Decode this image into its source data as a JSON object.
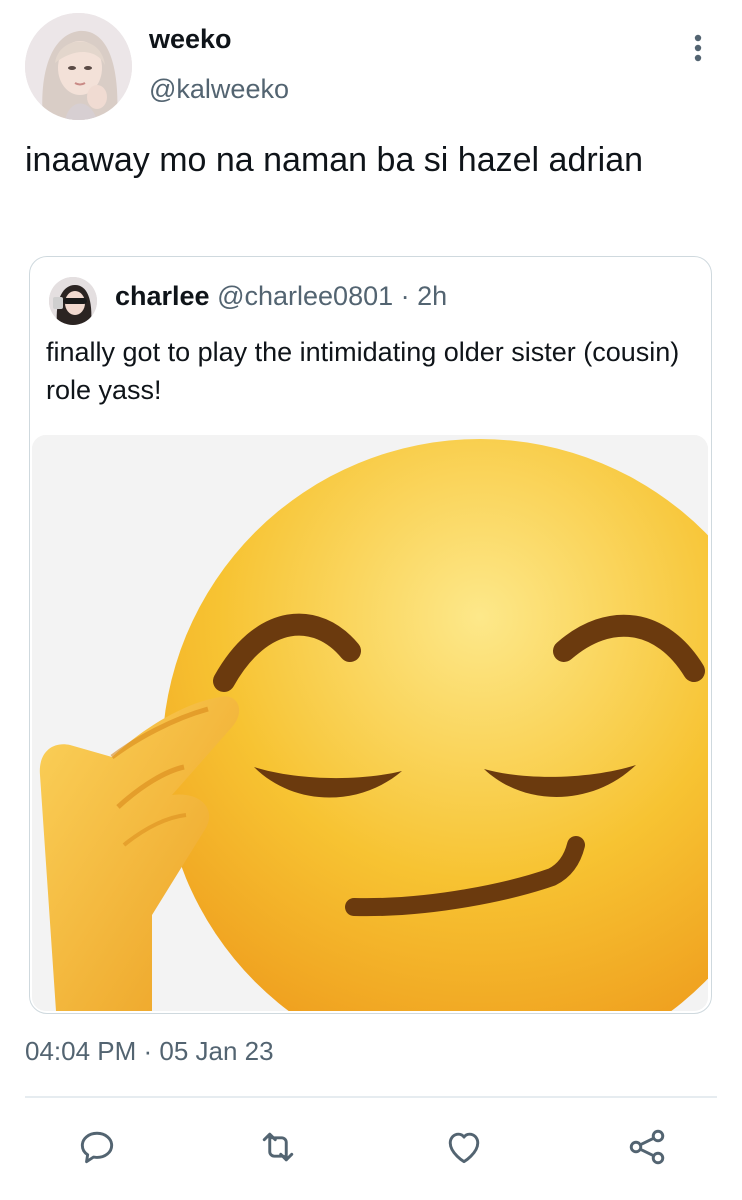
{
  "tweet": {
    "author_name": "weeko",
    "author_handle": "@kalweeko",
    "text": "inaaway mo na naman ba si hazel adrian",
    "timestamp": "04:04 PM · 05 Jan 23"
  },
  "quoted": {
    "author_name": "charlee",
    "author_handle": "@charlee0801",
    "age": "2h",
    "text": "finally got to play the intimidating older sister (cousin) role yass!",
    "media_icon": "saluting-smirk-emoji"
  },
  "actions": [
    {
      "icon": "reply-icon"
    },
    {
      "icon": "retweet-icon"
    },
    {
      "icon": "like-icon"
    },
    {
      "icon": "share-icon"
    }
  ],
  "colors": {
    "text": "#0f1419",
    "secondary": "#536471",
    "border": "#cfd9de",
    "emoji_face": "#f7c332"
  }
}
